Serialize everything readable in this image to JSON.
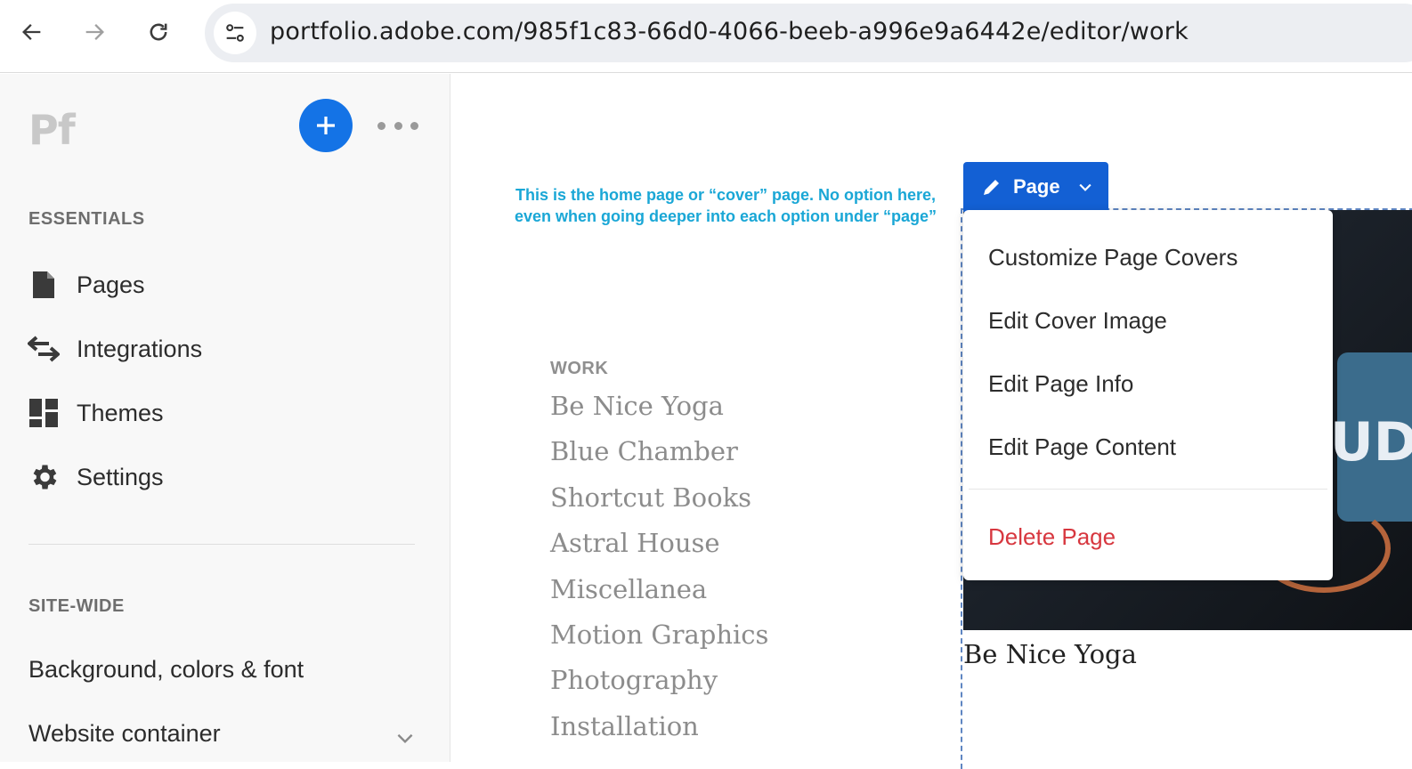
{
  "browser": {
    "url": "portfolio.adobe.com/985f1c83-66d0-4066-beeb-a996e9a6442e/editor/work"
  },
  "sidebar": {
    "logo": "Pf",
    "essentials_title": "ESSENTIALS",
    "items": [
      {
        "label": "Pages",
        "icon": "page-icon"
      },
      {
        "label": "Integrations",
        "icon": "arrows-icon"
      },
      {
        "label": "Themes",
        "icon": "themes-icon"
      },
      {
        "label": "Settings",
        "icon": "gear-icon"
      }
    ],
    "sitewide_title": "SITE-WIDE",
    "sitewide_items": [
      {
        "label": "Background, colors & font"
      },
      {
        "label": "Website container"
      }
    ]
  },
  "main": {
    "annotation": "This is the home page or “cover” page. No option here, even when going deeper into each option under “page”",
    "page_button": "Page",
    "work_label": "WORK",
    "work_items": [
      "Be Nice Yoga",
      "Blue Chamber",
      "Shortcut Books",
      "Astral House",
      "Miscellanea",
      "Motion Graphics",
      "Photography",
      "Installation"
    ],
    "cover_caption": "Be Nice Yoga",
    "cover_image_text": "UD"
  },
  "menu": {
    "items": [
      "Customize Page Covers",
      "Edit Cover Image",
      "Edit Page Info",
      "Edit Page Content"
    ],
    "delete": "Delete Page"
  },
  "colors": {
    "accent": "#1473e6",
    "page_button": "#1360d4",
    "annotation": "#1aa7d6",
    "danger": "#d7373f"
  }
}
